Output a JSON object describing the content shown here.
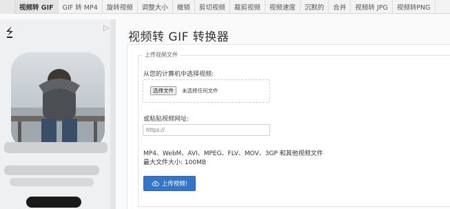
{
  "tabs": [
    {
      "label": "视频转 GIF",
      "active": true
    },
    {
      "label": "GIF 转 MP4",
      "active": false
    },
    {
      "label": "旋转视频",
      "active": false
    },
    {
      "label": "调整大小",
      "active": false
    },
    {
      "label": "撤销",
      "active": false
    },
    {
      "label": "剪切视频",
      "active": false
    },
    {
      "label": "裁剪视频",
      "active": false
    },
    {
      "label": "视频速度",
      "active": false
    },
    {
      "label": "沉默的",
      "active": false
    },
    {
      "label": "合并",
      "active": false
    },
    {
      "label": "视频转 JPG",
      "active": false
    },
    {
      "label": "视频转PNG",
      "active": false
    }
  ],
  "ad": {
    "logo_icon": "brand-logo-icon",
    "close_icon": "ad-close-icon"
  },
  "main": {
    "title": "视频转 GIF 转换器",
    "legend": "上传视频文件",
    "choose_label": "从您的计算机中选择视频:",
    "file_button": "选择文件",
    "file_status": "未选择任何文件",
    "url_label": "或粘贴视频网址:",
    "url_placeholder": "https://",
    "formats_text": "MP4、WebM、AVI、MPEG、FLV、MOV、3GP 和其他视频文件",
    "maxsize_text": "最大文件大小: 100MB",
    "upload_button": "上传视频!",
    "upload_icon": "cloud-upload-icon"
  },
  "colors": {
    "accent": "#3376c9",
    "tab_active_bg": "#e4e4e4"
  }
}
